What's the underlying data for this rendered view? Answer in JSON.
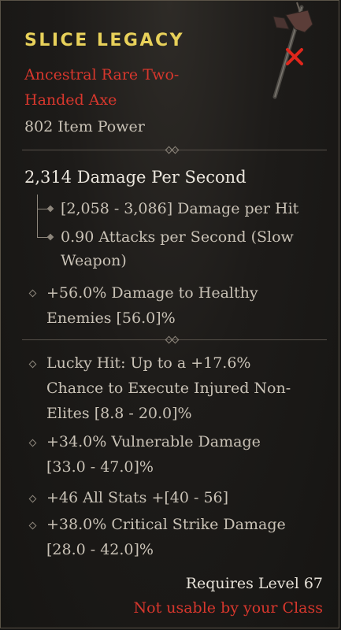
{
  "item": {
    "name": "SLICE LEGACY",
    "type_line1": "Ancestral Rare Two-",
    "type_line2": "Handed Axe",
    "item_power": "802 Item Power"
  },
  "damage": {
    "dps": "2,314 Damage Per Second",
    "per_hit": "[2,058 - 3,086] Damage per Hit",
    "attack_speed_line1": "0.90 Attacks per Second (Slow",
    "attack_speed_line2": "Weapon)"
  },
  "implicit": {
    "line1": "+56.0% Damage to Healthy",
    "line2": "Enemies [56.0]%"
  },
  "affixes": [
    {
      "lines": [
        "Lucky Hit: Up to a +17.6%",
        "Chance to Execute Injured Non-",
        "Elites [8.8 - 20.0]%"
      ]
    },
    {
      "lines": [
        "+34.0% Vulnerable Damage",
        "[33.0 - 47.0]%"
      ]
    },
    {
      "lines": [
        "+46 All Stats +[40 - 56]"
      ]
    },
    {
      "lines": [
        "+38.0% Critical Strike Damage",
        "[28.0 - 42.0]%"
      ]
    }
  ],
  "requirements": {
    "level": "Requires Level 67",
    "class_restriction": "Not usable by your Class"
  },
  "colors": {
    "title": "#e8d15a",
    "rarity": "#d8372d",
    "restriction": "#d8372d",
    "unusable_mark": "#e0261c"
  },
  "icons": {
    "weapon": "axe-icon",
    "unusable": "red-x-icon",
    "bullet": "diamond-bullet-icon"
  }
}
